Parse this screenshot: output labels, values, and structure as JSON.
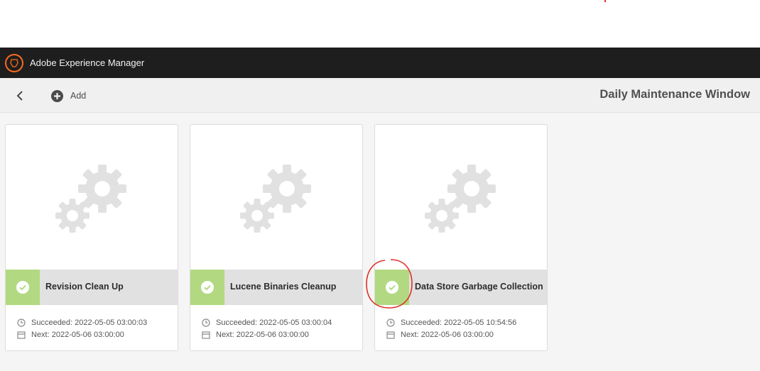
{
  "shell": {
    "app_title": "Adobe Experience Manager",
    "logo_icon": "adobe-logo-icon"
  },
  "actionbar": {
    "back_icon": "chevron-left-icon",
    "add_label": "Add",
    "add_icon": "add-circle-icon",
    "page_title": "Daily Maintenance Window"
  },
  "colors": {
    "accent": "#fa6b1d",
    "status_success": "#b2d981",
    "shell_bg": "#1e1e1e",
    "annotation": "#e0302a"
  },
  "tasks": [
    {
      "title": "Revision Clean Up",
      "status": "success",
      "succeeded": "Succeeded: 2022-05-05 03:00:03",
      "next": "Next: 2022-05-06 03:00:00"
    },
    {
      "title": "Lucene Binaries Cleanup",
      "status": "success",
      "succeeded": "Succeeded: 2022-05-05 03:00:04",
      "next": "Next: 2022-05-06 03:00:00"
    },
    {
      "title": "Data Store Garbage Collection",
      "status": "success",
      "succeeded": "Succeeded: 2022-05-05 10:54:56",
      "next": "Next: 2022-05-06 03:00:00"
    }
  ]
}
